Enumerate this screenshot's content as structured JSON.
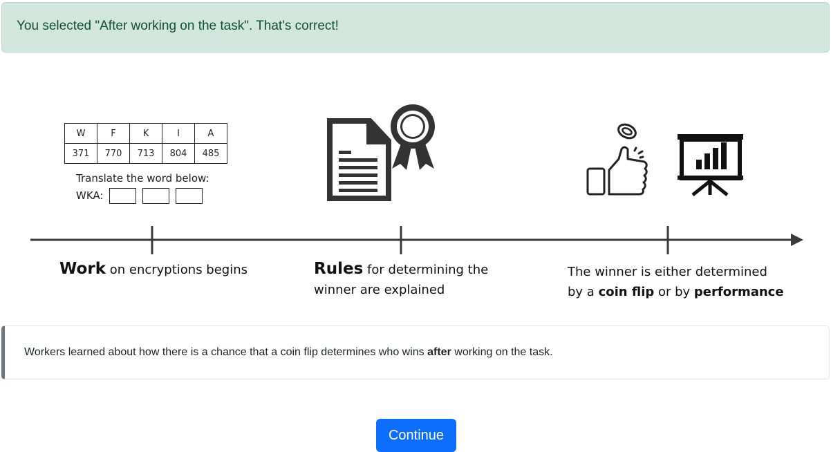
{
  "alert": {
    "text": "You selected \"After working on the task\". That's correct!"
  },
  "timeline": {
    "cipher_table": {
      "letters": [
        "W",
        "F",
        "K",
        "I",
        "A"
      ],
      "numbers": [
        "371",
        "770",
        "713",
        "804",
        "485"
      ]
    },
    "translate_prompt": "Translate the word below:",
    "translate_word": "WKA:",
    "step1": {
      "bold": "Work",
      "rest": " on encryptions begins"
    },
    "step2": {
      "bold": "Rules",
      "rest1": " for determining the",
      "line2": "winner are explained"
    },
    "step3": {
      "line1": "The winner is either determined",
      "pre": "by a ",
      "bold1": "coin flip",
      "mid": " or by ",
      "bold2": "performance"
    },
    "icons": [
      "document-icon",
      "award-ribbon-icon",
      "coin-icon",
      "thumbs-up-icon",
      "presentation-chart-icon"
    ]
  },
  "callout": {
    "pre": "Workers learned about how there is a chance that a coin flip determines who wins ",
    "bold": "after",
    "post": " working on the task."
  },
  "continue_button": {
    "label": "Continue"
  },
  "colors": {
    "alert_bg": "#d1e7dd",
    "alert_text": "#0f5132",
    "button": "#0d6efd",
    "callout_border": "#6c757d"
  }
}
